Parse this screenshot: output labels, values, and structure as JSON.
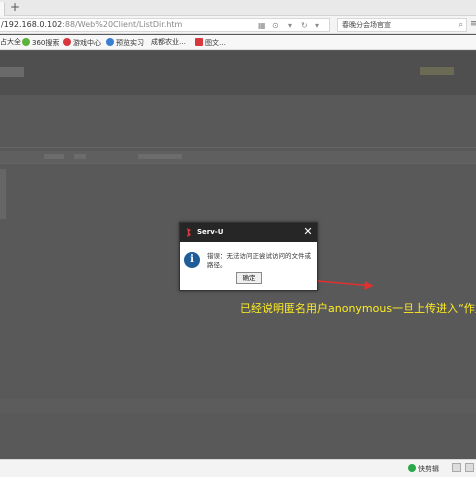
{
  "browser": {
    "new_tab_icon": "plus-icon",
    "url_main": "/192.168.0.102",
    "url_tail": ":88/Web%20Client/ListDir.htm",
    "search_text": "春晚分会场官宣",
    "bookmarks": [
      "占大全",
      "360搜索",
      "游戏中心",
      "预览实习",
      "成都农业…",
      "图文…"
    ]
  },
  "page": {
    "status_items": [
      "快剪辑"
    ]
  },
  "dialog": {
    "title": "Serv-U",
    "message": "错误：无法访问正尝试访问的文件或路径。",
    "ok_label": "确定",
    "close_glyph": "✕"
  },
  "annotation": {
    "text": "已经说明匿名用户anonymous一旦上传进入“作业",
    "color": "#ffee22",
    "arrow_color": "#e03030"
  },
  "colors": {
    "overlay": "#595959",
    "dialog_titlebar": "#262626",
    "info_icon": "#1f5d98"
  }
}
